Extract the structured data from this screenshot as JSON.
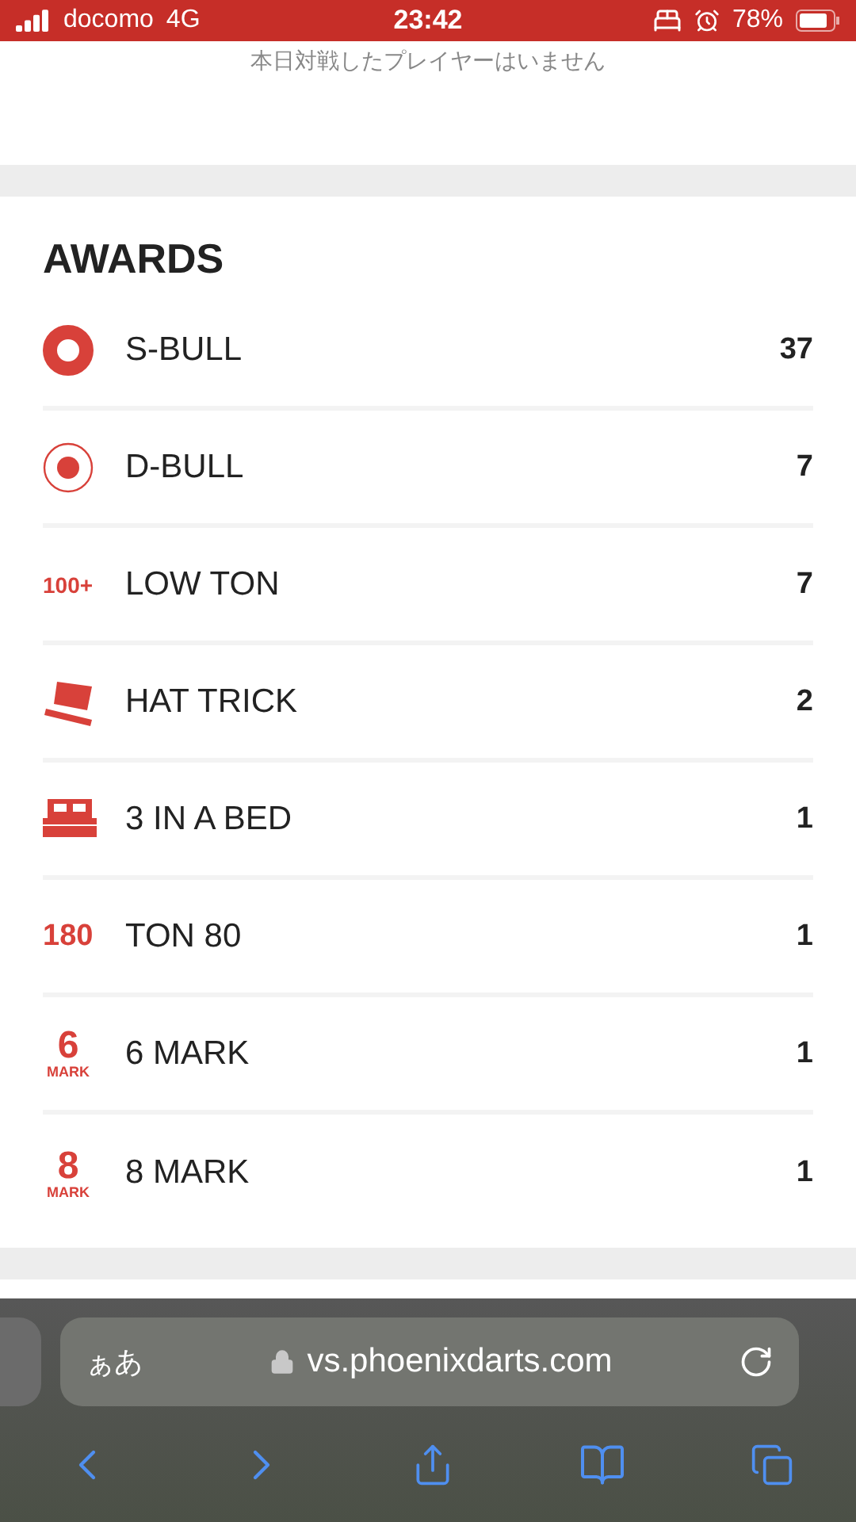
{
  "status_bar": {
    "carrier": "docomo",
    "network": "4G",
    "time": "23:42",
    "battery": "78%"
  },
  "notice": "本日対戦したプレイヤーはいません",
  "awards": {
    "title": "AWARDS",
    "items": [
      {
        "kind": "single-bull",
        "label": "S-BULL",
        "count": "37"
      },
      {
        "kind": "double-bull",
        "label": "D-BULL",
        "count": "7"
      },
      {
        "kind": "text",
        "icon_text": "100+",
        "label": "LOW TON",
        "count": "7"
      },
      {
        "kind": "hat",
        "label": "HAT TRICK",
        "count": "2"
      },
      {
        "kind": "bed",
        "label": "3 IN A BED",
        "count": "1"
      },
      {
        "kind": "text",
        "icon_text": "180",
        "label": "TON 80",
        "count": "1"
      },
      {
        "kind": "mark",
        "icon_text": "6",
        "icon_sub": "MARK",
        "label": "6 MARK",
        "count": "1"
      },
      {
        "kind": "mark",
        "icon_text": "8",
        "icon_sub": "MARK",
        "label": "8 MARK",
        "count": "1"
      }
    ]
  },
  "browser": {
    "text_size": "ぁあ",
    "url": "vs.phoenixdarts.com"
  }
}
